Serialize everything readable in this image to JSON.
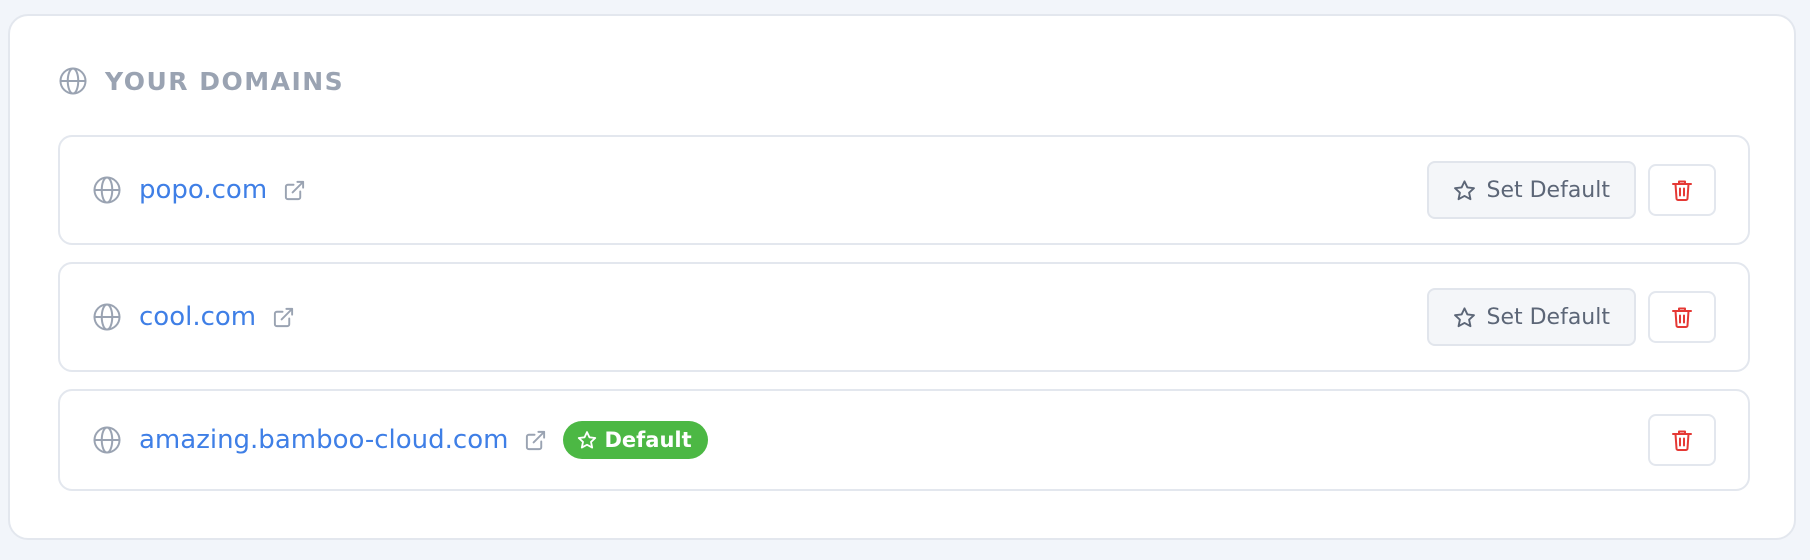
{
  "section": {
    "title": "YOUR DOMAINS",
    "icon": "globe-icon"
  },
  "colors": {
    "link": "#3f7fe6",
    "badge": "#4cb844",
    "delete": "#e53935",
    "muted": "#9aa3b2"
  },
  "domains": [
    {
      "name": "popo.com",
      "is_default": false,
      "set_default_label": "Set Default"
    },
    {
      "name": "cool.com",
      "is_default": false,
      "set_default_label": "Set Default"
    },
    {
      "name": "amazing.bamboo-cloud.com",
      "is_default": true,
      "badge_label": "Default"
    }
  ]
}
